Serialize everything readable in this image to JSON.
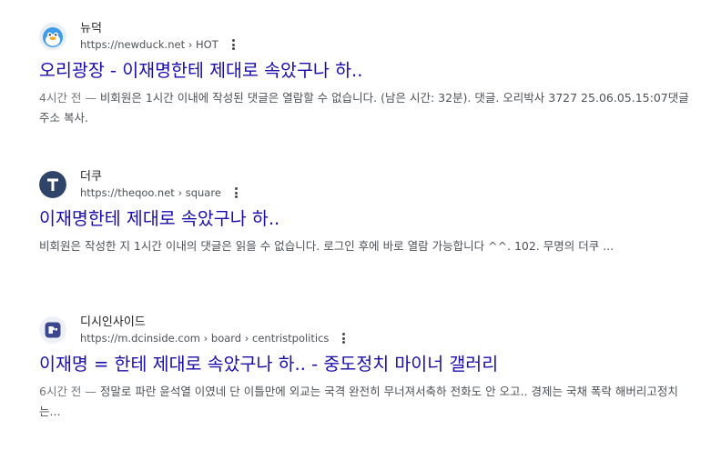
{
  "results": [
    {
      "site_name": "뉴덕",
      "url": "https://newduck.net",
      "breadcrumb": [
        "HOT"
      ],
      "title": "오리광장 - 이재명한테 제대로 속았구나 하..",
      "snippet_date": "4시간 전 — ",
      "snippet": "비회원은 1시간 이내에 작성된 댓글은 열람할 수 없습니다. (남은 시간: 32분). 댓글. 오리박사 3727 25.06.05.15:07댓글 주소 복사.",
      "favicon": "duck-icon"
    },
    {
      "site_name": "더쿠",
      "url": "https://theqoo.net",
      "breadcrumb": [
        "square"
      ],
      "title": "이재명한테 제대로 속았구나 하..",
      "snippet_date": "",
      "snippet": "비회원은 작성한 지 1시간 이내의 댓글은 읽을 수 없습니다. 로그인 후에 바로 열람 가능합니다 ^^. 102. 무명의 더쿠 ...",
      "favicon": "theqoo-t-icon"
    },
    {
      "site_name": "디시인사이드",
      "url": "https://m.dcinside.com",
      "breadcrumb": [
        "board",
        "centristpolitics"
      ],
      "title": "이재명 = 한테 제대로 속았구나 하.. - 중도정치 마이너 갤러리",
      "snippet_date": "6시간 전 — ",
      "snippet": "정말로 파란 윤석열 이였네 단 이틀만에 외교는 국격 완전히 무너져서축하 전화도 안 오고.. 경제는 국채 폭락 해버리고정치는...",
      "favicon": "dcinside-icon"
    }
  ],
  "colors": {
    "title_link": "#1a0dab",
    "snippet_text": "#4d5156",
    "theqoo_badge": "#2f4468",
    "dcinside_badge": "#3b4890"
  }
}
